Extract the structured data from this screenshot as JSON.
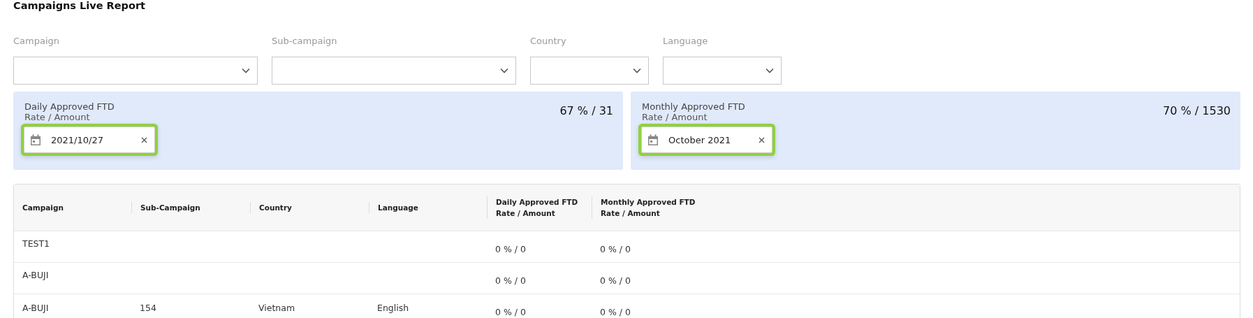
{
  "title": "Campaigns Live Report",
  "filters": [
    {
      "label": "Campaign"
    },
    {
      "label": "Sub-campaign"
    },
    {
      "label": "Country"
    },
    {
      "label": "Language"
    }
  ],
  "cards": [
    {
      "title": "Daily Approved FTD",
      "subtitle": "Rate / Amount",
      "value": "67 % / 31",
      "date": "2021/10/27",
      "focused": true
    },
    {
      "title": "Monthly Approved FTD",
      "subtitle": "Rate / Amount",
      "value": "70 % / 1530",
      "date": "October 2021",
      "focused": true
    }
  ],
  "table": {
    "columns": [
      {
        "title": "Campaign"
      },
      {
        "title": "Sub-Campaign"
      },
      {
        "title": "Country"
      },
      {
        "title": "Language"
      },
      {
        "title": "Daily Approved FTD",
        "subtitle": "Rate / Amount"
      },
      {
        "title": "Monthly Approved FTD",
        "subtitle": "Rate / Amount"
      }
    ],
    "rows": [
      [
        "TEST1",
        "",
        "",
        "",
        "0 % / 0",
        "0 % / 0"
      ],
      [
        "A-BUJI",
        "",
        "",
        "",
        "0 % / 0",
        "0 % / 0"
      ],
      [
        "A-BUJI",
        "154",
        "Vietnam",
        "English",
        "0 % / 0",
        "0 % / 0"
      ]
    ]
  }
}
